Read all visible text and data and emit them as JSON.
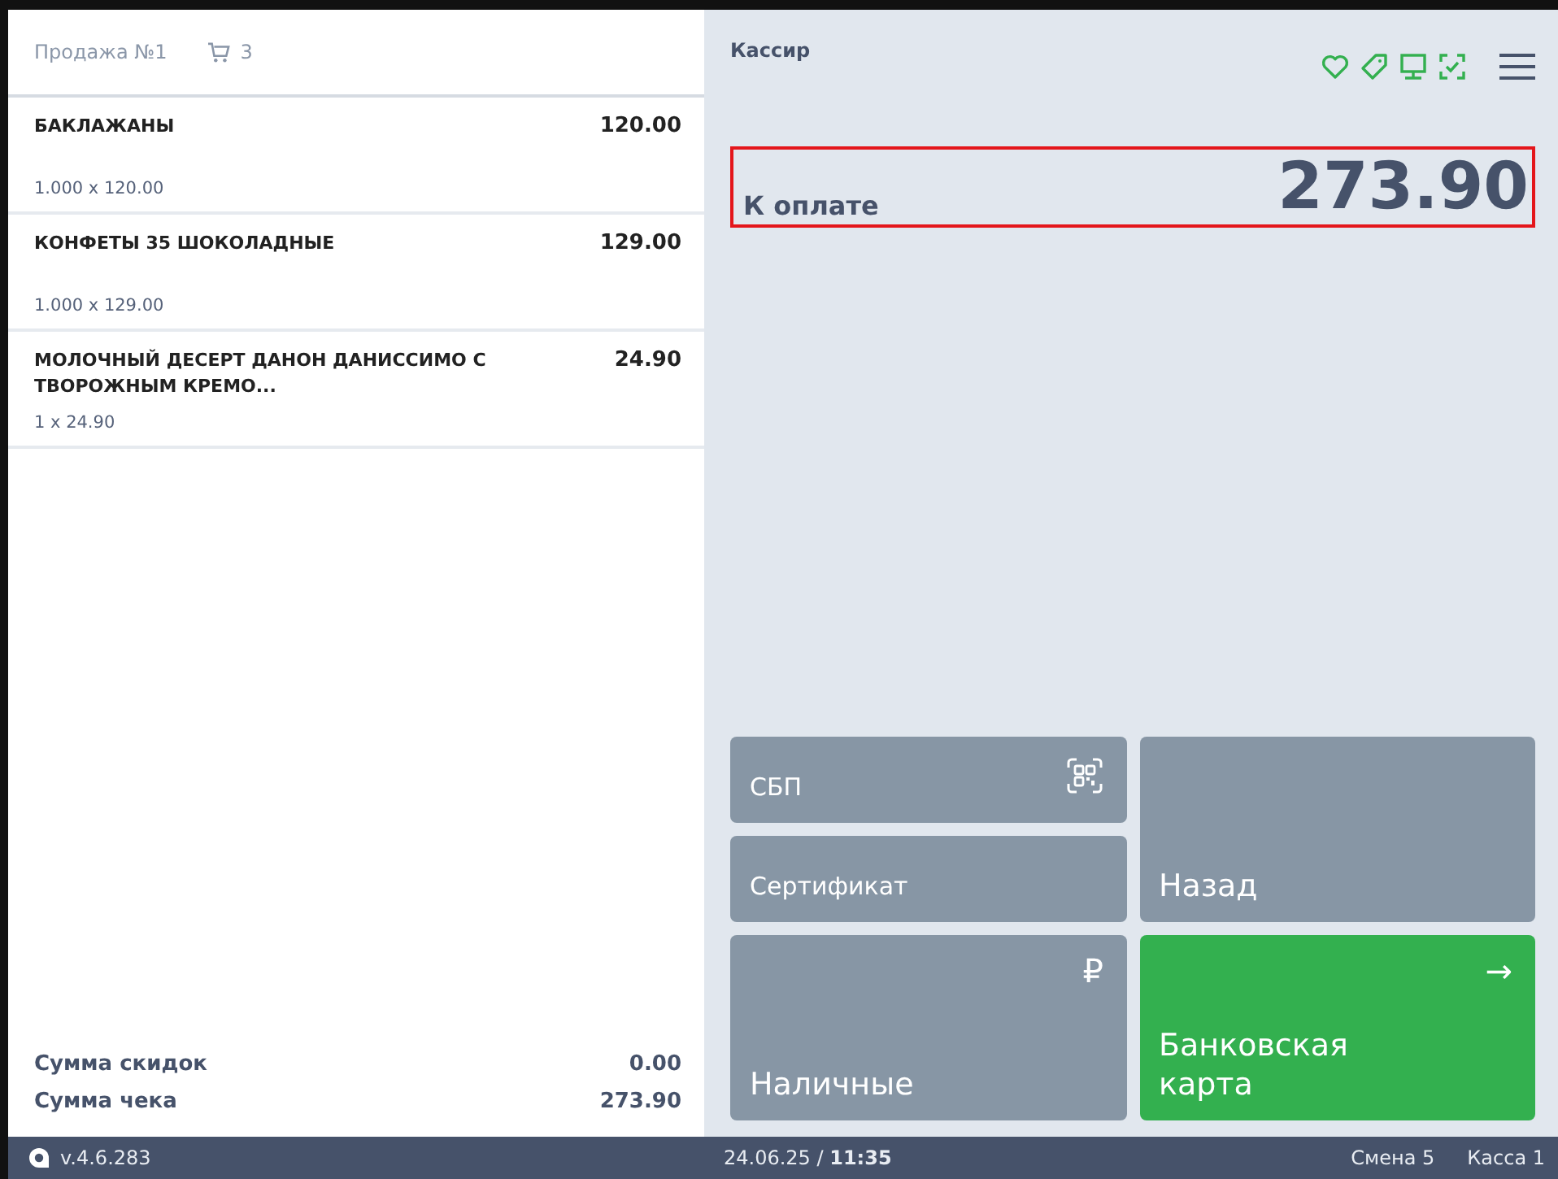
{
  "sale": {
    "title": "Продажа №1",
    "cart_count": "3"
  },
  "items": [
    {
      "name": "БАКЛАЖАНЫ",
      "price": "120.00",
      "qty": "1.000 x 120.00"
    },
    {
      "name": "КОНФЕТЫ 35 ШОКОЛАДНЫЕ",
      "price": "129.00",
      "qty": "1.000 x 129.00"
    },
    {
      "name": "МОЛОЧНЫЙ ДЕСЕРТ ДАНОН ДАНИССИМО С ТВОРОЖНЫМ КРЕМО...",
      "price": "24.90",
      "qty": "1 x 24.90"
    }
  ],
  "totals": [
    {
      "label": "Сумма скидок",
      "value": "0.00"
    },
    {
      "label": "Сумма чека",
      "value": "273.90"
    }
  ],
  "cashier": "Кассир",
  "due": {
    "label": "К оплате",
    "amount": "273.90",
    "highlighted": true
  },
  "payments": [
    {
      "kind": "qr",
      "label": "СБП"
    },
    {
      "kind": "plain",
      "label": "Сертификат"
    },
    {
      "kind": "back",
      "label": "Назад"
    },
    {
      "kind": "cash",
      "label": "Наличные",
      "icon": "₽"
    },
    {
      "kind": "card",
      "label": "Банковская карта",
      "icon": "→"
    }
  ],
  "status_bar": {
    "version": "v.4.6.283",
    "date": "24.06.25",
    "separator": "/",
    "time": "11:35",
    "shift": "Смена 5",
    "register": "Касса 1"
  }
}
